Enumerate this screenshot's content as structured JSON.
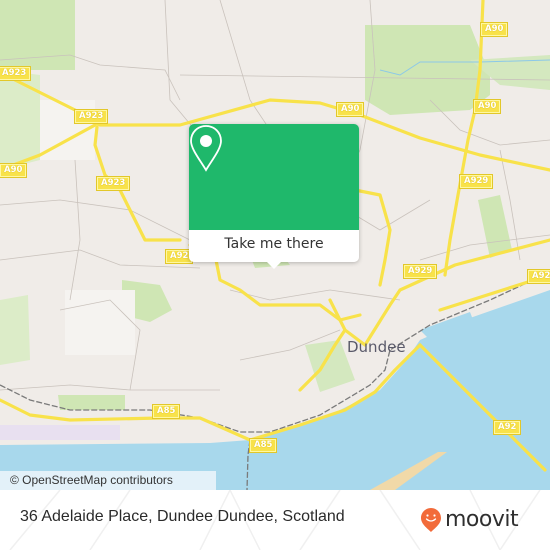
{
  "map": {
    "city_label": "Dundee",
    "road_labels": [
      {
        "id": "a923-west",
        "text": "A923"
      },
      {
        "id": "a923-mid",
        "text": "A923"
      },
      {
        "id": "a923-south",
        "text": "A923"
      },
      {
        "id": "a90-west",
        "text": "A90"
      },
      {
        "id": "a90-north",
        "text": "A90"
      },
      {
        "id": "a90-center",
        "text": "A90"
      },
      {
        "id": "a90-east",
        "text": "A90"
      },
      {
        "id": "a929-north",
        "text": "A929"
      },
      {
        "id": "a929-south",
        "text": "A929"
      },
      {
        "id": "a92-west",
        "text": "A92"
      },
      {
        "id": "a92-east",
        "text": "A92"
      },
      {
        "id": "a92-bridge",
        "text": "A92"
      },
      {
        "id": "a85-west",
        "text": "A85"
      },
      {
        "id": "a85-east",
        "text": "A85"
      }
    ],
    "attribution": "© OpenStreetMap contributors",
    "colors": {
      "land": "#f0ece8",
      "park": "#cfe6b4",
      "water": "#a8d8ec",
      "road_major": "#f8e24a",
      "sand": "#f1d9a8"
    }
  },
  "popup": {
    "button_label": "Take me there",
    "icon": "map-pin-icon",
    "color": "#1fb86b"
  },
  "footer": {
    "address": "36 Adelaide Place, Dundee Dundee, Scotland",
    "brand": "moovit",
    "brand_color": "#f26b3a"
  }
}
